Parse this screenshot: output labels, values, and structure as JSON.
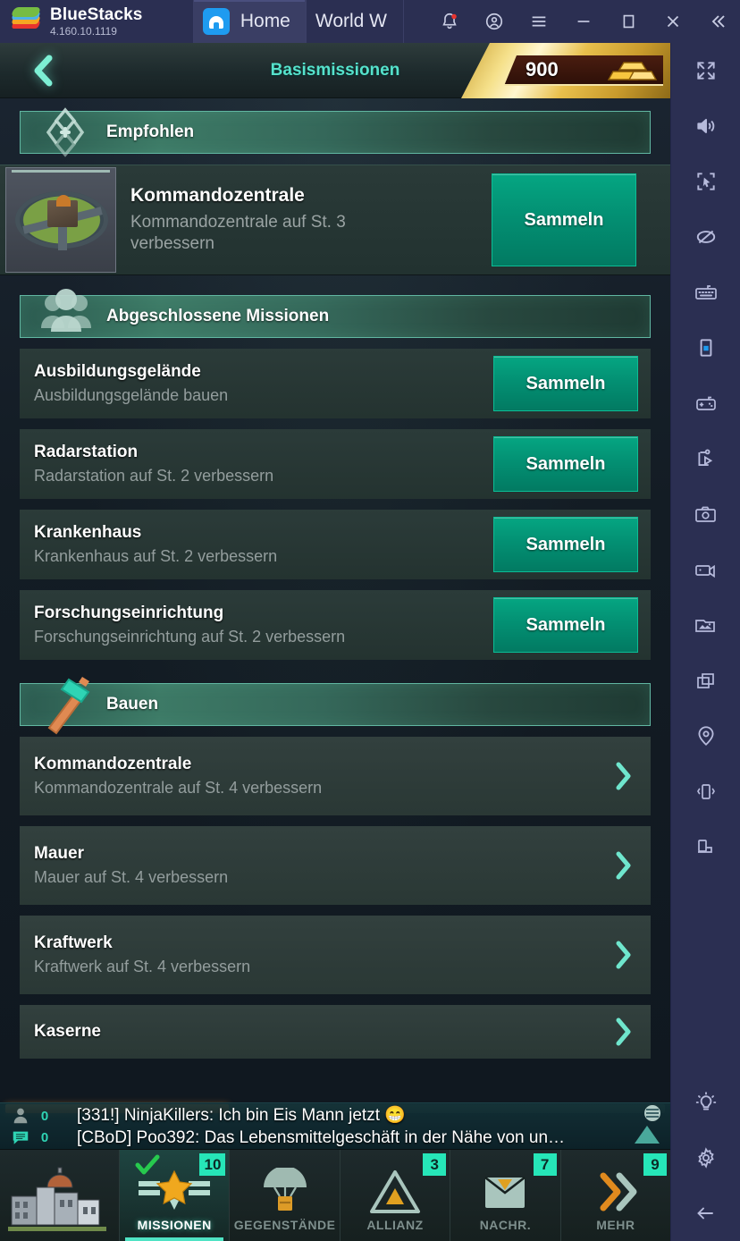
{
  "bluestacks": {
    "brand": "BlueStacks",
    "version": "4.160.10.1119",
    "tabs": [
      {
        "label": "Home",
        "icon": "home-icon",
        "active": true
      },
      {
        "label": "World W",
        "icon": "game-icon",
        "active": false
      }
    ],
    "window_controls": [
      "notification-bell-icon",
      "account-icon",
      "menu-icon",
      "minimize-icon",
      "maximize-icon",
      "close-icon",
      "collapse-icon"
    ]
  },
  "sidebar": {
    "items": [
      {
        "name": "fullscreen-icon"
      },
      {
        "name": "volume-icon"
      },
      {
        "name": "pointer-select-icon"
      },
      {
        "name": "eye-off-icon"
      },
      {
        "name": "keyboard-icon"
      },
      {
        "name": "rotate-portrait-icon"
      },
      {
        "name": "gamepad-icon"
      },
      {
        "name": "script-play-icon"
      },
      {
        "name": "screenshot-camera-icon"
      },
      {
        "name": "video-record-icon"
      },
      {
        "name": "media-gallery-icon"
      },
      {
        "name": "multi-instance-icon"
      },
      {
        "name": "location-pin-icon"
      },
      {
        "name": "shake-device-icon"
      },
      {
        "name": "rotate-landscape-icon"
      }
    ],
    "bottom_items": [
      {
        "name": "lightbulb-icon"
      },
      {
        "name": "settings-gear-icon"
      },
      {
        "name": "back-arrow-icon"
      }
    ]
  },
  "game": {
    "header": {
      "back_icon": "back-chevron-icon",
      "title": "Basismissionen",
      "currency_value": "900",
      "currency_icon": "gold-bars-icon"
    },
    "sections": [
      {
        "id": "recommended",
        "icon": "diamond-star-icon",
        "label": "Empfohlen",
        "kind": "recommended",
        "items": [
          {
            "title": "Kommandozentrale",
            "desc": "Kommandozentrale auf St. 3 verbessern",
            "action": "Sammeln",
            "thumb": "command-center-thumb"
          }
        ]
      },
      {
        "id": "completed",
        "icon": "people-group-icon",
        "label": "Abgeschlossene Missionen",
        "kind": "collect",
        "items": [
          {
            "title": "Ausbildungsgelände",
            "desc": "Ausbildungsgelände bauen",
            "action": "Sammeln"
          },
          {
            "title": "Radarstation",
            "desc": "Radarstation auf St. 2 verbessern",
            "action": "Sammeln"
          },
          {
            "title": "Krankenhaus",
            "desc": "Krankenhaus auf St. 2 verbessern",
            "action": "Sammeln"
          },
          {
            "title": "Forschungseinrichtung",
            "desc": "Forschungseinrichtung auf St. 2 verbessern",
            "action": "Sammeln"
          }
        ]
      },
      {
        "id": "build",
        "icon": "hammer-icon",
        "label": "Bauen",
        "kind": "navigate",
        "items": [
          {
            "title": "Kommandozentrale",
            "desc": "Kommandozentrale auf St. 4 verbessern"
          },
          {
            "title": "Mauer",
            "desc": "Mauer auf St. 4 verbessern"
          },
          {
            "title": "Kraftwerk",
            "desc": "Kraftwerk auf St. 4 verbessern"
          },
          {
            "title": "Kaserne",
            "desc": ""
          }
        ]
      }
    ],
    "chat": {
      "rows": [
        {
          "icon": "person-icon",
          "count": "0",
          "text": "[331!] NinjaKillers: Ich bin Eis Mann jetzt 😁"
        },
        {
          "icon": "chat-bubble-icon",
          "count": "0",
          "text": "[CBoD] Poo392: Das Lebensmittelgeschäft in der Nähe von un…"
        }
      ],
      "expand_icon": "chat-expand-icon"
    },
    "bottom_nav": {
      "home_icon": "city-building-icon",
      "items": [
        {
          "label": "MISSIONEN",
          "icon": "missions-rank-icon",
          "badge": "10",
          "active": true,
          "check": true
        },
        {
          "label": "GEGENSTÄNDE",
          "icon": "parachute-crate-icon",
          "badge": "",
          "active": false
        },
        {
          "label": "ALLIANZ",
          "icon": "alliance-triangle-icon",
          "badge": "3",
          "active": false
        },
        {
          "label": "NACHR.",
          "icon": "mail-envelope-icon",
          "badge": "7",
          "active": false
        },
        {
          "label": "MEHR",
          "icon": "more-chevrons-icon",
          "badge": "9",
          "active": false
        }
      ]
    }
  },
  "colors": {
    "accent_teal": "#56e2cc",
    "collect_green": "#039073",
    "badge_green": "#26e6b8",
    "gold": "#e8bf4c",
    "scroll_orange": "#e8792a",
    "bluestacks_bg": "#2b2f52"
  }
}
